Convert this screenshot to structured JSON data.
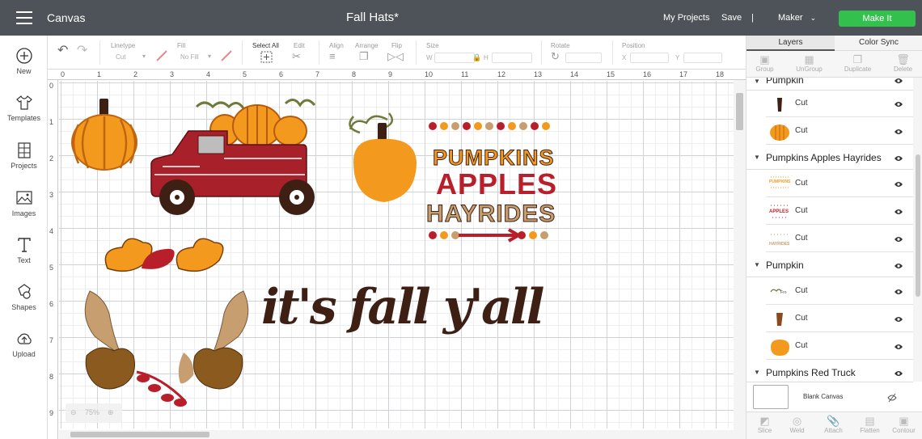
{
  "topbar": {
    "app_name": "Canvas",
    "title": "Fall Hats*",
    "my_projects": "My Projects",
    "save": "Save",
    "separator": "|",
    "machine": "Maker",
    "make_it": "Make It",
    "make_it_color": "#34c04c"
  },
  "leftbar": [
    {
      "label": "New",
      "icon": "plus-circle-icon"
    },
    {
      "label": "Templates",
      "icon": "shirt-icon"
    },
    {
      "label": "Projects",
      "icon": "projects-icon"
    },
    {
      "label": "Images",
      "icon": "image-icon"
    },
    {
      "label": "Text",
      "icon": "text-icon"
    },
    {
      "label": "Shapes",
      "icon": "shapes-icon"
    },
    {
      "label": "Upload",
      "icon": "upload-icon"
    }
  ],
  "toolbar": {
    "linetype_label": "Linetype",
    "linetype_value": "Cut",
    "fill_label": "Fill",
    "fill_value": "No Fill",
    "select_all": "Select All",
    "edit": "Edit",
    "align": "Align",
    "arrange": "Arrange",
    "flip": "Flip",
    "size": "Size",
    "size_w": "W",
    "size_h": "H",
    "rotate": "Rotate",
    "position": "Position",
    "pos_x": "X",
    "pos_y": "Y"
  },
  "ruler": {
    "h": [
      "0",
      "1",
      "2",
      "3",
      "4",
      "5",
      "6",
      "7",
      "8",
      "9",
      "10",
      "11",
      "12",
      "13",
      "14",
      "15",
      "16",
      "17",
      "18"
    ],
    "v": [
      "0",
      "1",
      "2",
      "3",
      "4",
      "5",
      "6",
      "7",
      "8",
      "9"
    ]
  },
  "zoom": "75%",
  "canvas": {
    "wordart": "it's fall y'all",
    "sign_lines": [
      "PUMPKINS",
      "APPLES",
      "HAYRIDES"
    ]
  },
  "panel": {
    "tabs": [
      "Layers",
      "Color Sync"
    ],
    "actions": [
      "Group",
      "UnGroup",
      "Duplicate",
      "Delete"
    ],
    "bottom_actions": [
      "Slice",
      "Weld",
      "Attach",
      "Flatten",
      "Contour"
    ],
    "blank_canvas": "Blank Canvas"
  },
  "layers": {
    "partial_group": "Pumpkin",
    "g1_rows": [
      {
        "label": "Cut"
      },
      {
        "label": "Cut"
      }
    ],
    "group2": "Pumpkins Apples Hayrides",
    "g2_rows": [
      {
        "label": "Cut",
        "thumb": "PUMPKINS"
      },
      {
        "label": "Cut",
        "thumb": "APPLES"
      },
      {
        "label": "Cut",
        "thumb": "HAYRIDES"
      }
    ],
    "group3": "Pumpkin",
    "g3_rows": [
      {
        "label": "Cut",
        "thumb": "Fro"
      },
      {
        "label": "Cut"
      },
      {
        "label": "Cut"
      }
    ],
    "group4": "Pumpkins Red Truck"
  },
  "colors": {
    "orange": "#f39a1e",
    "red": "#b81f2b",
    "brown": "#3d1f14",
    "tan": "#c79e6f",
    "truck_red": "#a8202a",
    "leaf_brown": "#8a5a1e"
  }
}
